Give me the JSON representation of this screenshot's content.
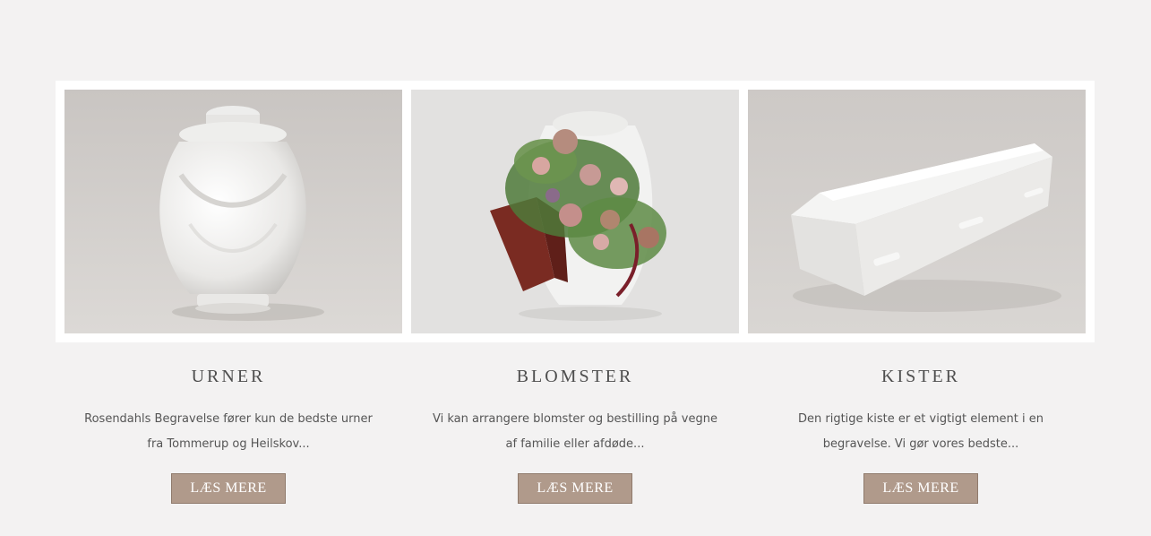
{
  "products": [
    {
      "title": "URNER",
      "description_line1": "Rosendahls Begravelse fører kun de bedste urner",
      "description_line2": "fra Tommerup og Heilskov...",
      "button_label": "LÆS MERE",
      "image": "urn-image"
    },
    {
      "title": "BLOMSTER",
      "description_line1": "Vi kan arrangere blomster og bestilling på vegne",
      "description_line2": "af familie eller afdøde...",
      "button_label": "LÆS MERE",
      "image": "flower-arrangement-image"
    },
    {
      "title": "KISTER",
      "description_line1": "Den rigtige kiste er et vigtigt element i en",
      "description_line2": "begravelse. Vi gør vores bedste...",
      "button_label": "LÆS MERE",
      "image": "coffin-image"
    }
  ],
  "colors": {
    "page_background": "#f3f2f2",
    "button_background": "#b09a8b",
    "title_text": "#4e4e4e"
  }
}
